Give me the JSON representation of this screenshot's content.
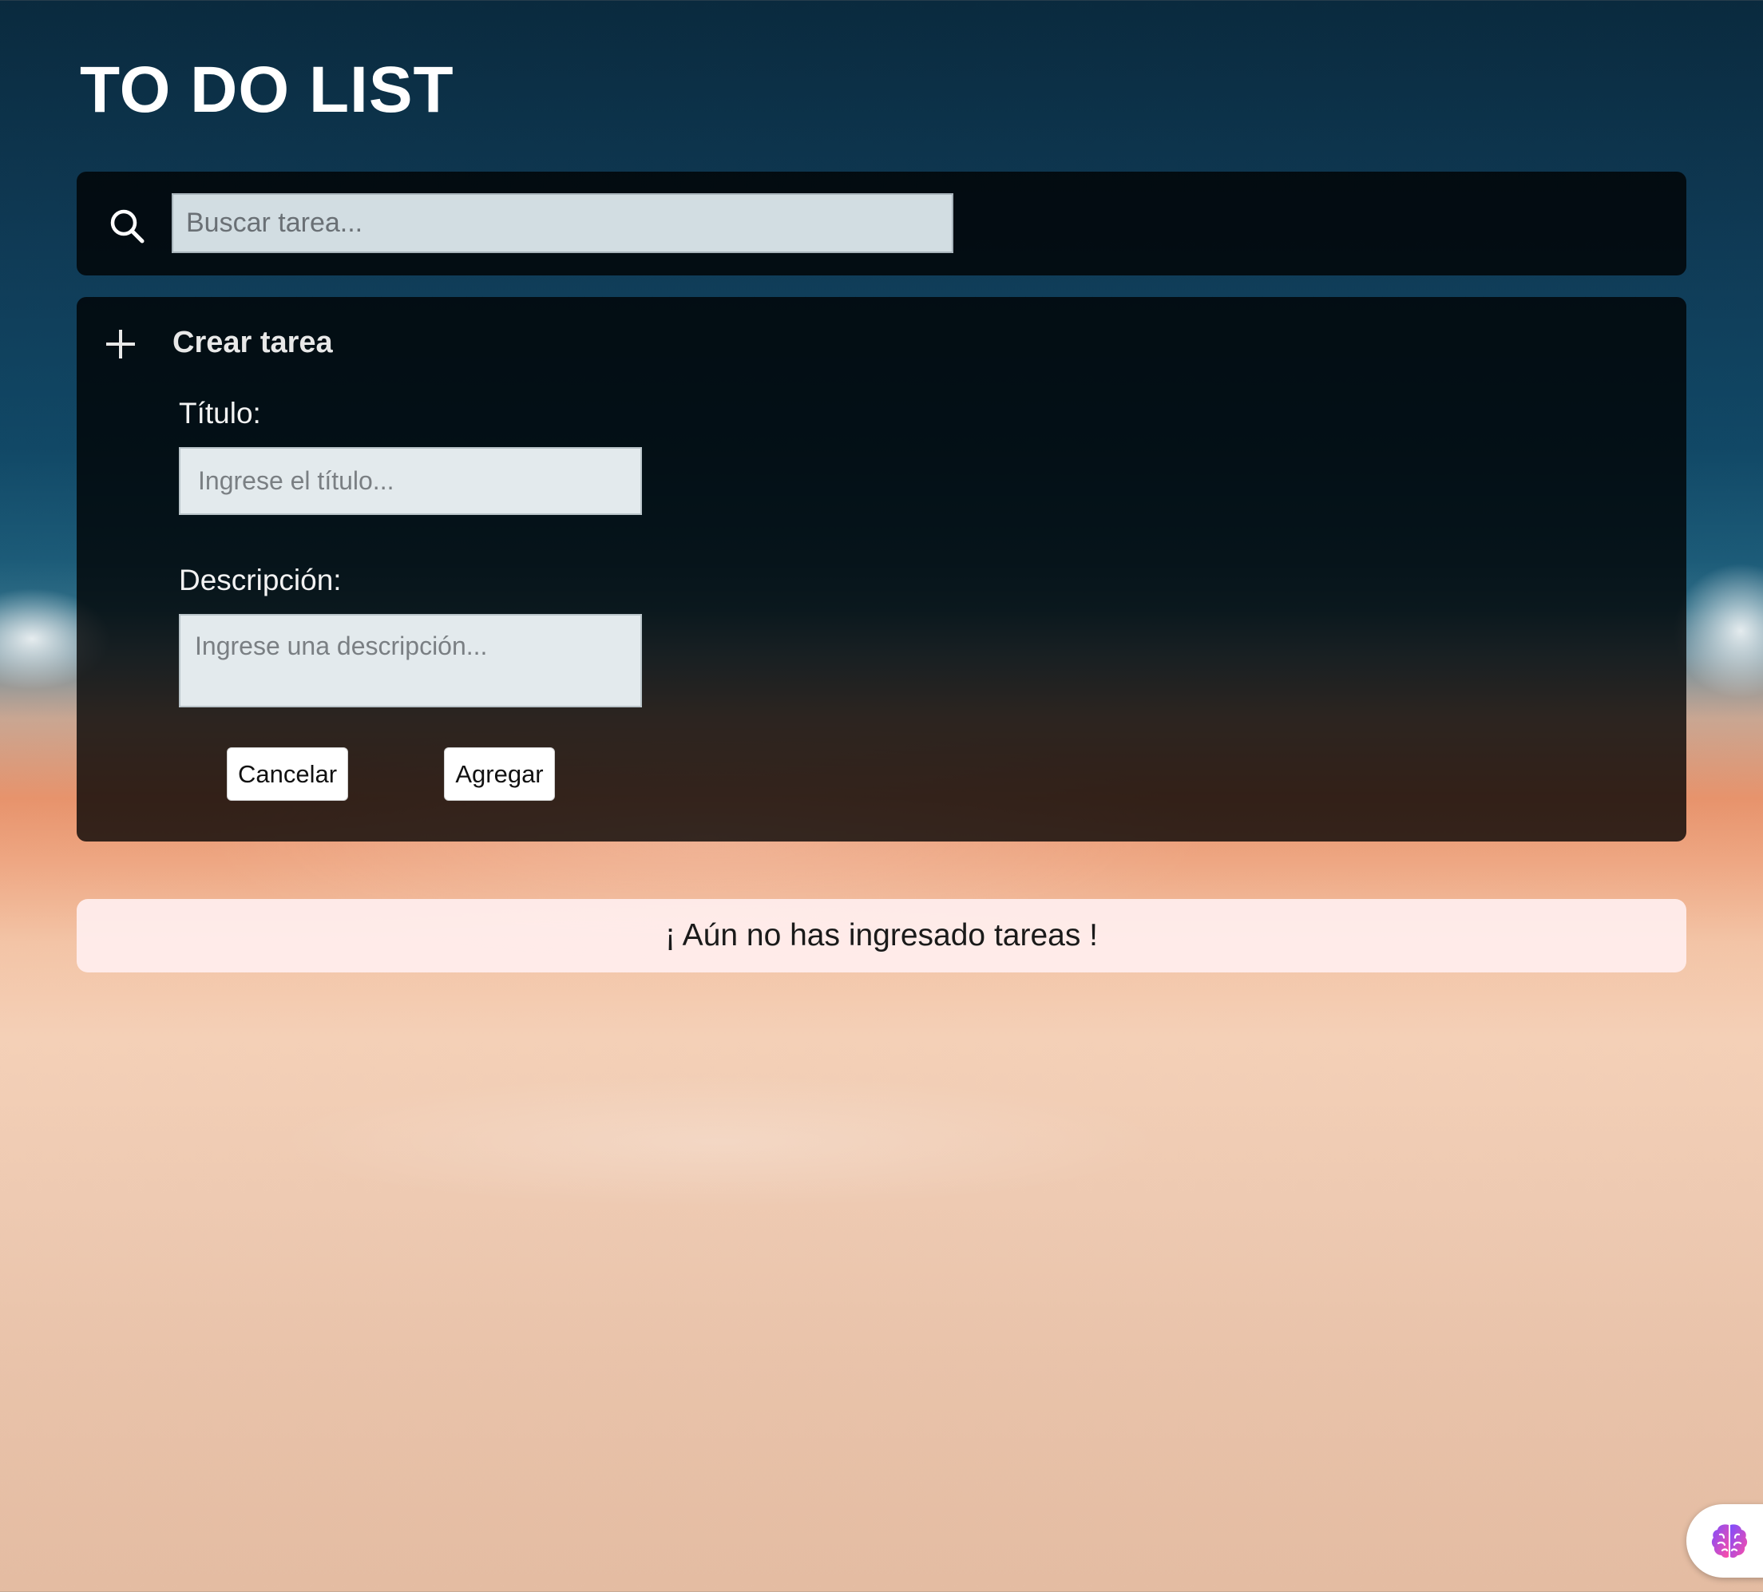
{
  "app": {
    "title": "TO DO LIST"
  },
  "search": {
    "placeholder": "Buscar tarea...",
    "value": ""
  },
  "create_task": {
    "heading": "Crear tarea",
    "title_label": "Título:",
    "title_placeholder": "Ingrese el título...",
    "title_value": "",
    "description_label": "Descripción:",
    "description_placeholder": "Ingrese una descripción...",
    "description_value": "",
    "cancel_label": "Cancelar",
    "add_label": "Agregar"
  },
  "tasks": {
    "empty_message": "¡ Aún no has ingresado tareas !",
    "items": []
  },
  "icons": {
    "search": "search-icon",
    "plus": "plus-icon",
    "brain": "brain-icon"
  },
  "colors": {
    "panel_background": "#000000",
    "banner_background": "#ffeeee",
    "title_text": "#ffffff",
    "brain_gradient_start": "#7b4dff",
    "brain_gradient_end": "#ff4da6"
  }
}
